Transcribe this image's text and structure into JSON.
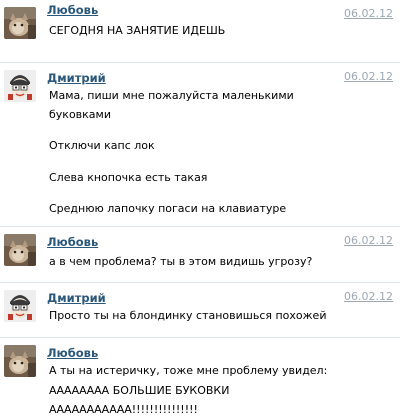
{
  "messages": [
    {
      "author": "Любовь",
      "date": "06.02.12",
      "avatar_icon": "cat-photo-avatar",
      "lines": [
        "СЕГОДНЯ НА ЗАНЯТИЕ  ИДЕШЬ"
      ]
    },
    {
      "author": "Дмитрий",
      "date": "06.02.12",
      "avatar_icon": "cartoon-face-avatar",
      "lines": [
        "Мама, пиши мне пожалуйста маленькими",
        "буковками",
        "Отключи капс лок",
        "Слева кнопочка есть такая",
        "Среднюю лапочку погаси на клавиатуре"
      ]
    },
    {
      "author": "Любовь",
      "date": "06.02.12",
      "avatar_icon": "cat-photo-avatar",
      "lines": [
        "а в чем проблема? ты в этом видишь угрозу?"
      ]
    },
    {
      "author": "Дмитрий",
      "date": "06.02.12",
      "avatar_icon": "cartoon-face-avatar",
      "lines": [
        "Просто ты на блондинку становишься  похожей"
      ]
    },
    {
      "author": "Любовь",
      "date": "",
      "avatar_icon": "cat-photo-avatar",
      "lines": [
        "А ты на истеричку, тоже мне проблему увидел:",
        "АААААААА  БОЛЬШИЕ БУКОВКИ",
        "ААААААААААА!!!!!!!!!!!!!!!"
      ]
    }
  ],
  "colors": {
    "author_link": "#2b587a",
    "date_link": "#9ea8b5",
    "divider": "#dce4ec"
  }
}
